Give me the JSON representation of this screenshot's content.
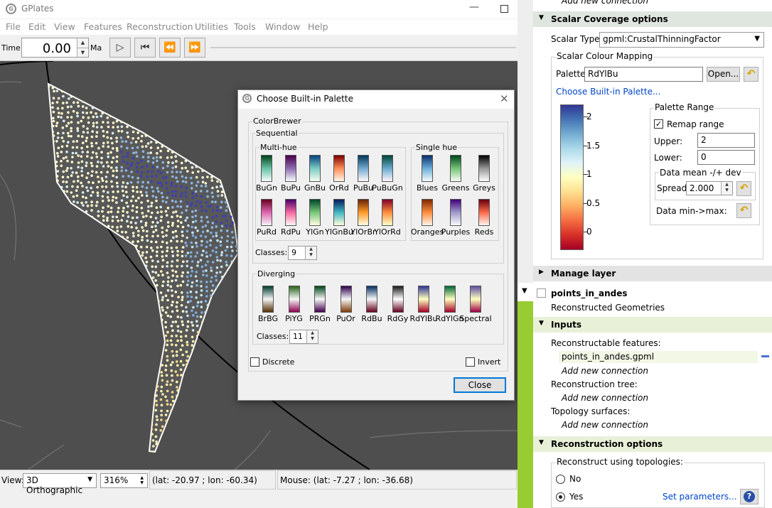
{
  "app": {
    "title": "GPlates"
  },
  "menu": [
    "File",
    "Edit",
    "View",
    "Features",
    "Reconstruction",
    "Utilities",
    "Tools",
    "Window",
    "Help"
  ],
  "timebar": {
    "time_label": "Time:",
    "time_value": "0.00",
    "unit": "Ma"
  },
  "statusbar": {
    "view_label": "View:",
    "projection": "3D Orthographic",
    "zoom": "316%",
    "camera_coords": "(lat: -20.97 ; lon: -60.34)",
    "mouse_coords": "Mouse: (lat: -7.27 ; lon: -36.68)"
  },
  "dialog": {
    "title": "Choose Built-in Palette",
    "colorbrewer_label": "ColorBrewer",
    "sequential_label": "Sequential",
    "multihue_label": "Multi-hue",
    "singlehue_label": "Single hue",
    "classes_label": "Classes:",
    "sequential_classes": "9",
    "diverging_label": "Diverging",
    "diverging_classes": "11",
    "discrete_label": "Discrete",
    "invert_label": "Invert",
    "close_label": "Close",
    "multihue": [
      "BuGn",
      "BuPu",
      "GnBu",
      "OrRd",
      "PuBu",
      "PuBuGn",
      "PuRd",
      "RdPu",
      "YlGn",
      "YlGnBu",
      "YlOrBr",
      "YlOrRd"
    ],
    "singlehue": [
      "Blues",
      "Greens",
      "Greys",
      "Oranges",
      "Purples",
      "Reds"
    ],
    "diverging": [
      "BrBG",
      "PiYG",
      "PRGn",
      "PuOr",
      "RdBu",
      "RdGy",
      "RdYlBu",
      "RdYlGn",
      "Spectral"
    ]
  },
  "panel": {
    "add_new_connection": "Add new connection",
    "scalar_coverage_header": "Scalar Coverage options",
    "scalar_type_label": "Scalar Type:",
    "scalar_type_value": "gpml:CrustalThinningFactor",
    "mapping_label": "Scalar Colour  Mapping",
    "palette_label": "Palette:",
    "palette_value": "RdYlBu",
    "open_label": "Open...",
    "choose_builtin_link": "Choose Built-in Palette...",
    "colorbar_ticks": [
      "2",
      "1.5",
      "1",
      "0.5",
      "0"
    ],
    "palette_range_label": "Palette Range",
    "remap_label": "Remap range",
    "upper_label": "Upper:",
    "upper_value": "2",
    "lower_label": "Lower:",
    "lower_value": "0",
    "mean_dev_label": "Data mean -/+ dev",
    "spread_label": "Spread:",
    "spread_value": "2.000",
    "minmax_label": "Data min->max:",
    "manage_layer_header": "Manage layer",
    "layer_name": "points_in_andes",
    "layer_type": "Reconstructed Geometries",
    "inputs_header": "Inputs",
    "reconstructable_label": "Reconstructable features:",
    "input_file": "points_in_andes.gpml",
    "recon_tree_label": "Reconstruction tree:",
    "topology_surfaces_label": "Topology surfaces:",
    "recon_options_header": "Reconstruction options",
    "recon_topologies_label": "Reconstruct using topologies:",
    "no_label": "No",
    "yes_label": "Yes",
    "set_params_link": "Set parameters...",
    "help_label": "?"
  }
}
